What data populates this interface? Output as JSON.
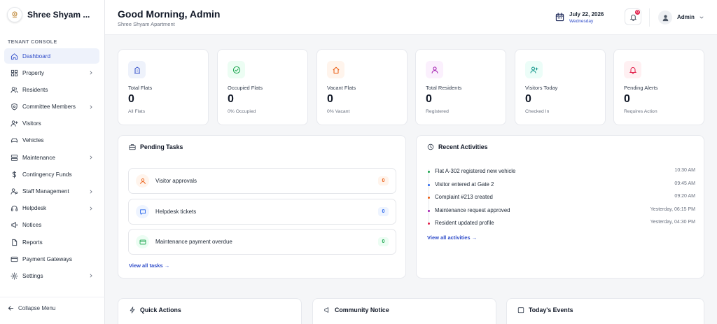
{
  "sidebar": {
    "brand": "Shree Shyam ...",
    "section_label": "TENANT CONSOLE",
    "items": [
      {
        "label": "Dashboard",
        "icon": "home-icon",
        "chevron": false,
        "active": true
      },
      {
        "label": "Property",
        "icon": "grid-icon",
        "chevron": true
      },
      {
        "label": "Residents",
        "icon": "users-icon",
        "chevron": false
      },
      {
        "label": "Committee Members",
        "icon": "shield-icon",
        "chevron": true
      },
      {
        "label": "Visitors",
        "icon": "user-plus-icon",
        "chevron": false
      },
      {
        "label": "Vehicles",
        "icon": "car-icon",
        "chevron": false
      },
      {
        "label": "Maintenance",
        "icon": "server-icon",
        "chevron": true
      },
      {
        "label": "Contingency Funds",
        "icon": "dollar-icon",
        "chevron": false
      },
      {
        "label": "Staff Management",
        "icon": "users-gear-icon",
        "chevron": true
      },
      {
        "label": "Helpdesk",
        "icon": "headphones-icon",
        "chevron": true
      },
      {
        "label": "Notices",
        "icon": "megaphone-icon",
        "chevron": false
      },
      {
        "label": "Reports",
        "icon": "file-icon",
        "chevron": false
      },
      {
        "label": "Payment Gateways",
        "icon": "credit-card-icon",
        "chevron": false
      },
      {
        "label": "Settings",
        "icon": "gear-icon",
        "chevron": true
      }
    ],
    "collapse_label": "Collapse Menu"
  },
  "header": {
    "greeting": "Good Morning, Admin",
    "subtitle": "Shree Shyam Apartment",
    "date": "July 22, 2026",
    "day": "Wednesday",
    "notification_count": "0",
    "user": "Admin"
  },
  "stats": [
    {
      "label": "Total Flats",
      "value": "0",
      "caption": "All Flats",
      "icon": "building-icon",
      "color": "#2f4cc9",
      "bg": "#eef2fb"
    },
    {
      "label": "Occupied Flats",
      "value": "0",
      "caption": "0% Occupied",
      "icon": "check-circle-icon",
      "color": "#16a34a",
      "bg": "#ecfdf3"
    },
    {
      "label": "Vacant Flats",
      "value": "0",
      "caption": "0% Vacant",
      "icon": "house-icon",
      "color": "#ea580c",
      "bg": "#fff4ec"
    },
    {
      "label": "Total Residents",
      "value": "0",
      "caption": "Registered",
      "icon": "user-icon",
      "color": "#a21caf",
      "bg": "#fbf0fd"
    },
    {
      "label": "Visitors Today",
      "value": "0",
      "caption": "Checked In",
      "icon": "user-plus-icon",
      "color": "#0d9488",
      "bg": "#ecfdf8"
    },
    {
      "label": "Pending Alerts",
      "value": "0",
      "caption": "Requires Action",
      "icon": "alert-bell-icon",
      "color": "#e11d48",
      "bg": "#fff0f2"
    }
  ],
  "pending_tasks": {
    "title": "Pending Tasks",
    "items": [
      {
        "label": "Visitor approvals",
        "count": "0",
        "icon": "user-icon",
        "color": "#ea580c",
        "bg": "#fff4ec"
      },
      {
        "label": "Helpdesk tickets",
        "count": "0",
        "icon": "chat-icon",
        "color": "#2563eb",
        "bg": "#eef4ff"
      },
      {
        "label": "Maintenance payment overdue",
        "count": "0",
        "icon": "credit-card-icon",
        "color": "#16a34a",
        "bg": "#ecfdf3"
      }
    ],
    "view_all": "View all tasks →"
  },
  "recent_activities": {
    "title": "Recent Activities",
    "items": [
      {
        "text": "Flat A-302 registered new vehicle",
        "time": "10:30 AM",
        "color": "#16a34a"
      },
      {
        "text": "Visitor entered at Gate 2",
        "time": "09:45 AM",
        "color": "#2563eb"
      },
      {
        "text": "Complaint #213 created",
        "time": "09:20 AM",
        "color": "#ea580c"
      },
      {
        "text": "Maintenance request approved",
        "time": "Yesterday, 06:15 PM",
        "color": "#a21caf"
      },
      {
        "text": "Resident updated profile",
        "time": "Yesterday, 04:30 PM",
        "color": "#e11d48"
      }
    ],
    "view_all": "View all activities →"
  },
  "bottom": {
    "quick_actions": "Quick Actions",
    "community_notice": "Community Notice",
    "todays_events": "Today's Events"
  }
}
